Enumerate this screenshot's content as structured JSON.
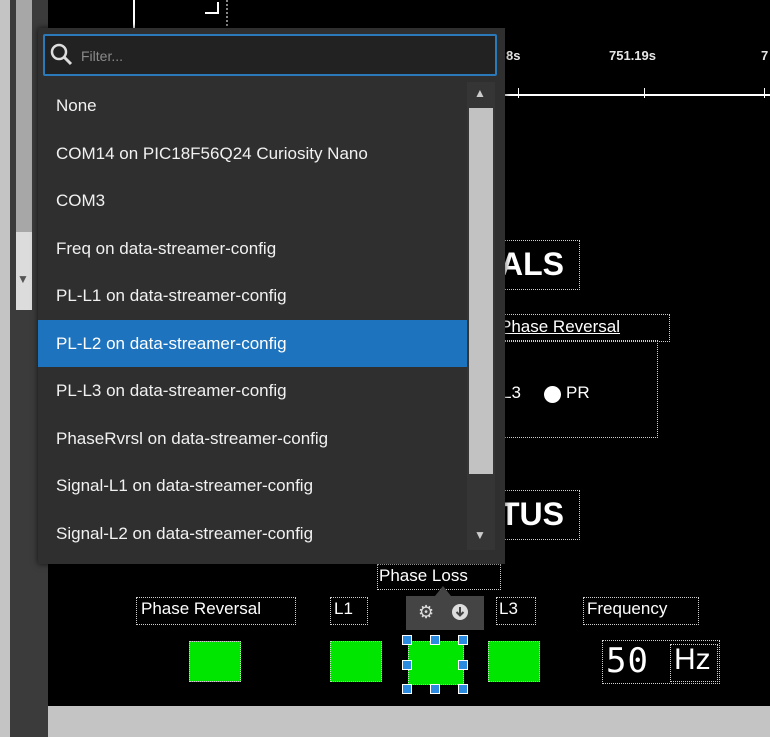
{
  "plot": {
    "axis_labels": [
      "8s",
      "751.19s",
      "7"
    ]
  },
  "sections": {
    "signals_title_partial": "ALS",
    "status_title_partial": "TUS"
  },
  "signals_panel": {
    "header_label": "Phase Reversal",
    "l3_label": "L3",
    "pr_label": "PR"
  },
  "status_panel": {
    "phase_loss_label": "Phase Loss",
    "labels": {
      "phase_reversal": "Phase Reversal",
      "l1": "L1",
      "l3": "L3",
      "frequency": "Frequency"
    },
    "frequency_value": "50",
    "frequency_unit": "Hz",
    "indicator_color": "#00e600"
  },
  "dropdown": {
    "filter_placeholder": "Filter...",
    "selected_index": 5,
    "options": [
      "None",
      "COM14 on PIC18F56Q24 Curiosity Nano",
      "COM3",
      "Freq on data-streamer-config",
      "PL-L1 on data-streamer-config",
      "PL-L2 on data-streamer-config",
      "PL-L3 on data-streamer-config",
      "PhaseRvrsl on data-streamer-config",
      "Signal-L1 on data-streamer-config",
      "Signal-L2 on data-streamer-config"
    ],
    "accent_color": "#1e73be"
  },
  "toolbar": {
    "icons": [
      "gear-icon",
      "download-circle-icon"
    ]
  }
}
